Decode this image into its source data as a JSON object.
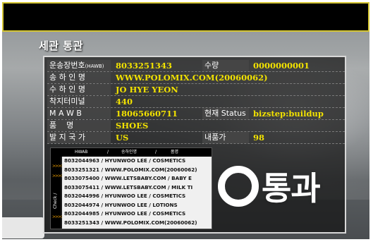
{
  "screen_title": "세관 통관",
  "fields": {
    "hawb": {
      "label": "운송장번호",
      "label_suffix": "(HAWB)",
      "value": "8033251343"
    },
    "qty": {
      "label": "수량",
      "value": "0000000001"
    },
    "sender": {
      "label": "송 하 인 명",
      "value": "WWW.POLOMIX.COM(20060062)"
    },
    "receiver": {
      "label": "수 하 인 명",
      "value": "JO HYE YEON"
    },
    "terminal": {
      "label": "착지터미널",
      "value": "440"
    },
    "mawb": {
      "label": "M A W B",
      "value": "18065660711"
    },
    "status": {
      "label": "현재 Status",
      "value": "bizstep:buildup"
    },
    "item": {
      "label": "품    명",
      "value": "SHOES"
    },
    "origin": {
      "label": "발 지 국 가",
      "value": "US"
    },
    "price": {
      "label": "내품가",
      "value": "98"
    }
  },
  "list": {
    "headers": {
      "hawb": "HWAB",
      "sep1": "/",
      "sender": "송하인명",
      "sep2": "/",
      "item": "품명"
    },
    "side_label": "Check /",
    "side_arrows": ">>>>",
    "items": [
      "8032044963 / HYUNWOO LEE / COSMETICS",
      "8033251321 / WWW.POLOMIX.COM(20060062)",
      "8033075400 / WWW.LETSBABY.COM / BABY E",
      "8033075411 / WWW.LETSBABY.COM / MILK TI",
      "8032044996 / HYUNWOO LEE / COSMETICS",
      "8032044974 / HYUNWOO LEE / LOTIONS",
      "8032044985 / HYUNWOO LEE / COSMETICS",
      "8033251343 / WWW.POLOMIX.COM(20060062)"
    ]
  },
  "result": {
    "text": "통과"
  },
  "colors": {
    "value_text": "#f2e200",
    "frame_border": "#d4c533",
    "arrow": "#f2a100"
  }
}
